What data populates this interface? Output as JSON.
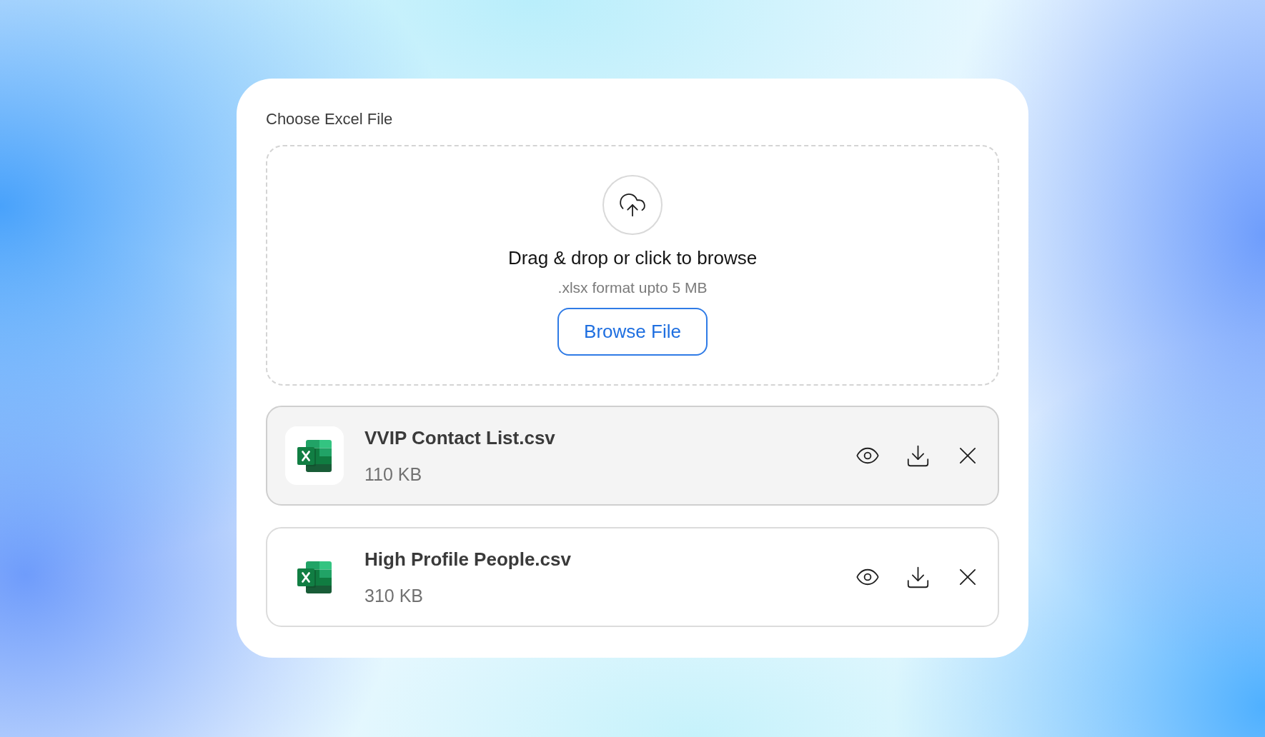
{
  "card": {
    "title": "Choose Excel File"
  },
  "dropzone": {
    "heading": "Drag & drop or click to browse",
    "hint": ".xlsx format upto 5 MB",
    "button": "Browse File"
  },
  "files": [
    {
      "name": "VVIP Contact List.csv",
      "size": "110 KB",
      "selected": true
    },
    {
      "name": "High Profile People.csv",
      "size": "310 KB",
      "selected": false
    }
  ]
}
